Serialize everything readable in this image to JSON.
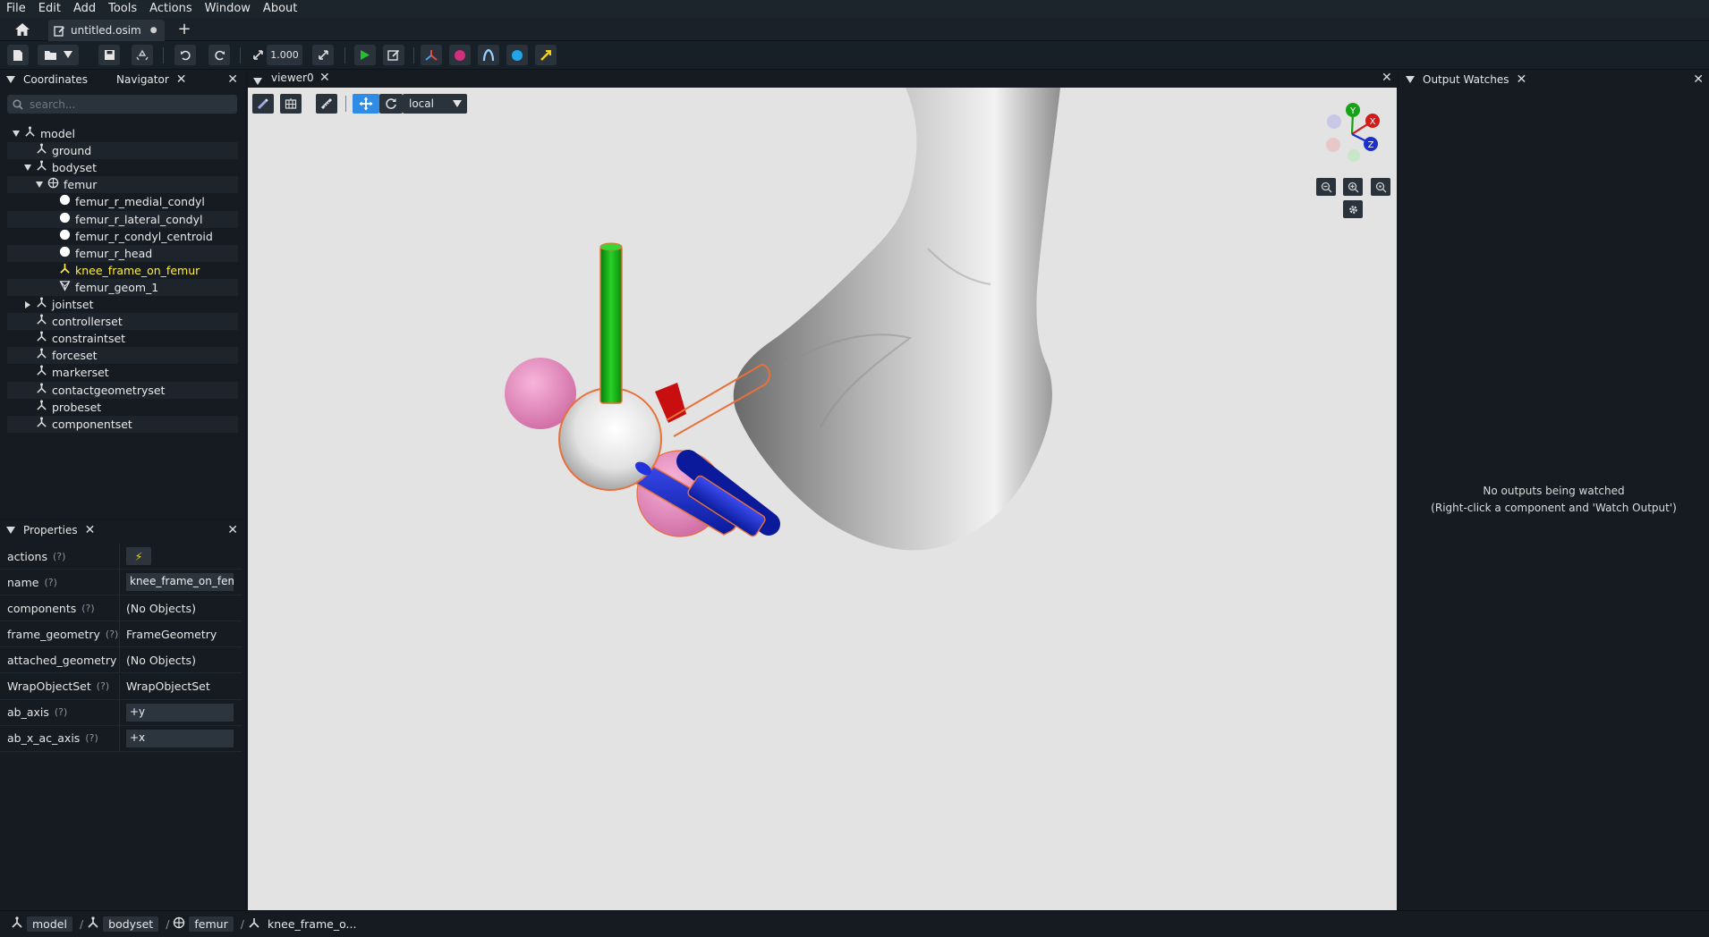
{
  "menu": [
    "File",
    "Edit",
    "Add",
    "Tools",
    "Actions",
    "Window",
    "About"
  ],
  "tab": {
    "title": "untitled.osim",
    "modified_dot": "●",
    "add": "+"
  },
  "toolbar": {
    "scale_value": "1.000"
  },
  "navigator": {
    "tab_coordinates": "Coordinates",
    "tab_navigator": "Navigator",
    "search_placeholder": "search...",
    "tree": [
      {
        "label": "model",
        "depth": 0,
        "expander": "open",
        "icon": "component-icon"
      },
      {
        "label": "ground",
        "depth": 1,
        "expander": "none",
        "icon": "component-icon"
      },
      {
        "label": "bodyset",
        "depth": 1,
        "expander": "open",
        "icon": "component-icon"
      },
      {
        "label": "femur",
        "depth": 2,
        "expander": "open",
        "icon": "body-icon"
      },
      {
        "label": "femur_r_medial_condyl",
        "depth": 3,
        "expander": "none",
        "icon": "marker-icon"
      },
      {
        "label": "femur_r_lateral_condyl",
        "depth": 3,
        "expander": "none",
        "icon": "marker-icon"
      },
      {
        "label": "femur_r_condyl_centroid",
        "depth": 3,
        "expander": "none",
        "icon": "marker-icon"
      },
      {
        "label": "femur_r_head",
        "depth": 3,
        "expander": "none",
        "icon": "marker-icon"
      },
      {
        "label": "knee_frame_on_femur",
        "depth": 3,
        "expander": "none",
        "icon": "frame-icon",
        "selected": true
      },
      {
        "label": "femur_geom_1",
        "depth": 3,
        "expander": "none",
        "icon": "mesh-icon"
      },
      {
        "label": "jointset",
        "depth": 1,
        "expander": "closed",
        "icon": "component-icon"
      },
      {
        "label": "controllerset",
        "depth": 1,
        "expander": "none",
        "icon": "component-icon"
      },
      {
        "label": "constraintset",
        "depth": 1,
        "expander": "none",
        "icon": "component-icon"
      },
      {
        "label": "forceset",
        "depth": 1,
        "expander": "none",
        "icon": "component-icon"
      },
      {
        "label": "markerset",
        "depth": 1,
        "expander": "none",
        "icon": "component-icon"
      },
      {
        "label": "contactgeometryset",
        "depth": 1,
        "expander": "none",
        "icon": "component-icon"
      },
      {
        "label": "probeset",
        "depth": 1,
        "expander": "none",
        "icon": "component-icon"
      },
      {
        "label": "componentset",
        "depth": 1,
        "expander": "none",
        "icon": "component-icon"
      }
    ]
  },
  "properties": {
    "title": "Properties",
    "help": "(?)",
    "rows": [
      {
        "key": "actions",
        "value": "⚡",
        "kind": "button"
      },
      {
        "key": "name",
        "value": "knee_frame_on_femur",
        "kind": "input"
      },
      {
        "key": "components",
        "value": "(No Objects)",
        "kind": "text"
      },
      {
        "key": "frame_geometry",
        "value": "FrameGeometry",
        "kind": "text"
      },
      {
        "key": "attached_geometry",
        "value": "(No Objects)",
        "kind": "text"
      },
      {
        "key": "WrapObjectSet",
        "value": "WrapObjectSet",
        "kind": "text"
      },
      {
        "key": "ab_axis",
        "value": "+y",
        "kind": "input"
      },
      {
        "key": "ab_x_ac_axis",
        "value": "+x",
        "kind": "input"
      }
    ]
  },
  "viewer": {
    "title": "viewer0",
    "frame_mode": "local",
    "axes": {
      "y": "Y",
      "x": "X",
      "z": "Z"
    }
  },
  "output_watches": {
    "title": "Output Watches",
    "empty_line1": "No outputs being watched",
    "empty_line2": "(Right-click a component and 'Watch Output')"
  },
  "breadcrumb": [
    "model",
    "bodyset",
    "femur",
    "knee_frame_o..."
  ],
  "colors": {
    "accent": "#2e8be6",
    "selected_text": "#ffef3b",
    "x_axis": "#d11a1a",
    "y_axis": "#17a317",
    "z_axis": "#1b2fcc",
    "marker_pink": "#f08fc2",
    "outline": "#e8703a"
  }
}
